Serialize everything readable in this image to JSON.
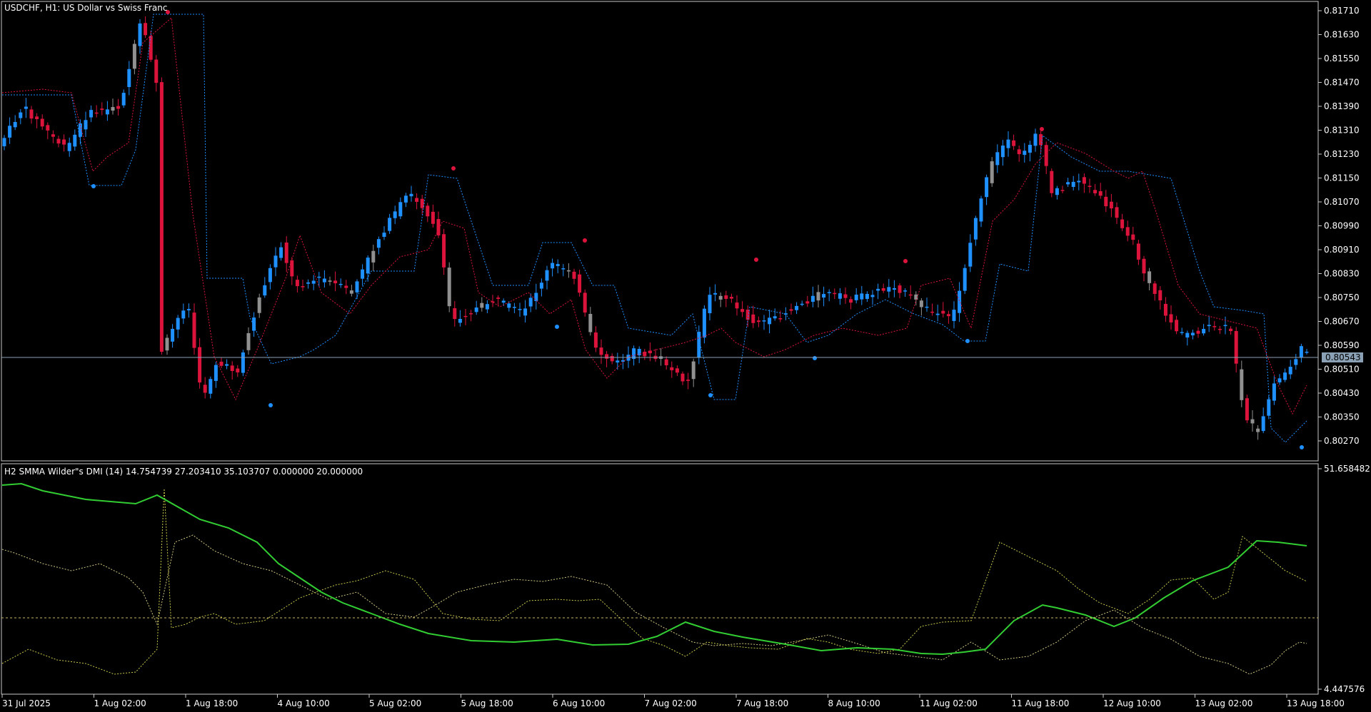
{
  "main_pane": {
    "title": "USDCHF, H1:  US Dollar vs Swiss Franc",
    "price_labels": [
      "0.81710",
      "0.81630",
      "0.81550",
      "0.81470",
      "0.81390",
      "0.81310",
      "0.81230",
      "0.81150",
      "0.81070",
      "0.80990",
      "0.80910",
      "0.80830",
      "0.80750",
      "0.80670",
      "0.80590",
      "0.80510",
      "0.80430",
      "0.80350",
      "0.80270"
    ],
    "current_price": "0.80543",
    "colors": {
      "bull": "#1e90ff",
      "bear": "#dc143c",
      "neutral": "#909090",
      "current_line": "#8aa0b4",
      "background": "#000000",
      "frame": "#c8c8c8"
    }
  },
  "indicator_pane": {
    "title": "H2 SMMA Wilder\"s DMI (14) 14.754739 27.203410 35.103707 0.000000 20.000000",
    "scale_max": "51.658482",
    "scale_min": "4.447576",
    "colors": {
      "adx": "#32cd32",
      "plus_di": "#c8c84a",
      "minus_di": "#d2c882",
      "level": "#c8b464"
    }
  },
  "time_labels": [
    "31 Jul 2025",
    "1 Aug 02:00",
    "1 Aug 18:00",
    "4 Aug 10:00",
    "5 Aug 02:00",
    "5 Aug 18:00",
    "6 Aug 10:00",
    "7 Aug 02:00",
    "7 Aug 18:00",
    "8 Aug 10:00",
    "11 Aug 02:00",
    "11 Aug 18:00",
    "12 Aug 10:00",
    "13 Aug 02:00",
    "13 Aug 18:00"
  ]
}
